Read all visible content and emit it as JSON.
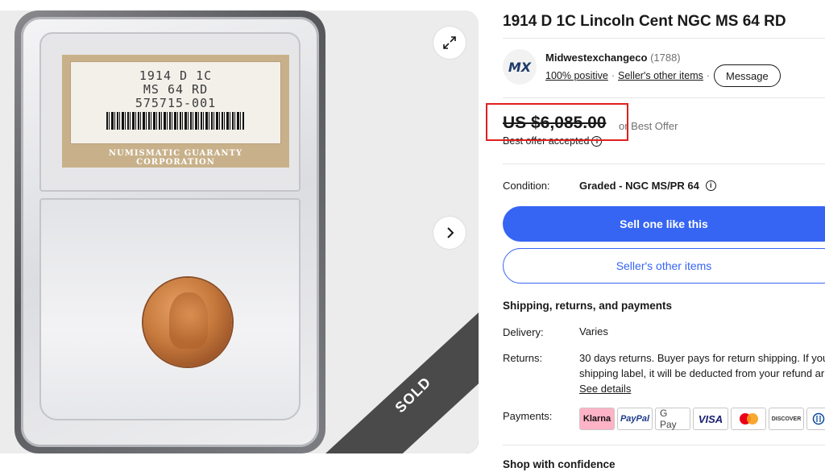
{
  "gallery": {
    "slab_label": {
      "line1": "1914 D 1C",
      "line2": "MS 64 RD",
      "line3": "575715-001",
      "brand": "NUMISMATIC GUARANTY CORPORATION"
    },
    "sold_ribbon": "SOLD",
    "expand_icon": "expand-icon",
    "next_icon": "chevron-right-icon"
  },
  "listing": {
    "title": "1914 D 1C Lincoln Cent NGC MS 64 RD"
  },
  "seller": {
    "logo_text": "MX",
    "name": "Midwestexchangeco",
    "feedback_count": "(1788)",
    "positive": "100% positive",
    "other_items": "Seller's other items",
    "message_button": "Message"
  },
  "price": {
    "amount": "US $6,085.00",
    "offer_suffix": "or Best Offer",
    "accepted": "Best offer accepted",
    "highlight_color": "#e0201d"
  },
  "condition": {
    "label": "Condition:",
    "value": "Graded - NGC MS/PR 64"
  },
  "actions": {
    "primary": "Sell one like this",
    "secondary": "Seller's other items",
    "primary_color": "#3665f3"
  },
  "shipping": {
    "title": "Shipping, returns, and payments",
    "delivery_label": "Delivery:",
    "delivery_value": "Varies",
    "returns_label": "Returns:",
    "returns_line1": "30 days returns. Buyer pays for return shipping. If you",
    "returns_line2": "shipping label, it will be deducted from your refund ar",
    "returns_link": "See details",
    "payments_label": "Payments:",
    "payments": [
      "Klarna",
      "PayPal",
      "G Pay",
      "VISA",
      "",
      "DISCOVER",
      ""
    ]
  },
  "confidence": {
    "title": "Shop with confidence"
  }
}
